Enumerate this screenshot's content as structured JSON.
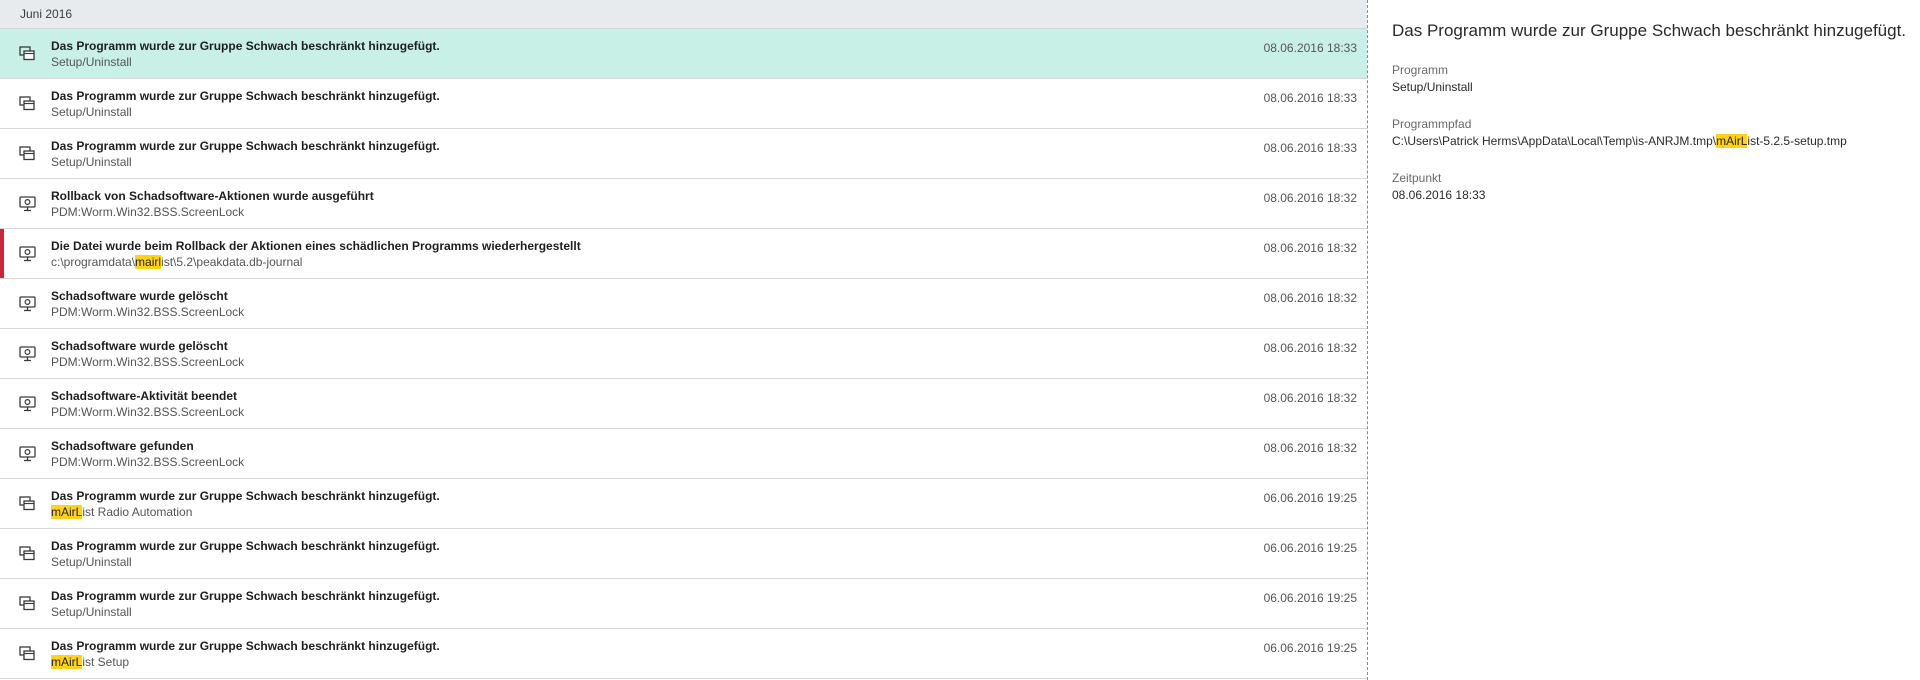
{
  "list": {
    "group_header": "Juni 2016",
    "rows": [
      {
        "icon": "app-window-icon",
        "title": "Das Programm wurde zur Gruppe Schwach beschränkt hinzugefügt.",
        "sub_pre": "Setup/Uninstall",
        "sub_hl": "",
        "sub_post": "",
        "time": "08.06.2016 18:33",
        "selected": true,
        "flagged": false
      },
      {
        "icon": "app-window-icon",
        "title": "Das Programm wurde zur Gruppe Schwach beschränkt hinzugefügt.",
        "sub_pre": "Setup/Uninstall",
        "sub_hl": "",
        "sub_post": "",
        "time": "08.06.2016 18:33",
        "selected": false,
        "flagged": false
      },
      {
        "icon": "app-window-icon",
        "title": "Das Programm wurde zur Gruppe Schwach beschränkt hinzugefügt.",
        "sub_pre": "Setup/Uninstall",
        "sub_hl": "",
        "sub_post": "",
        "time": "08.06.2016 18:33",
        "selected": false,
        "flagged": false
      },
      {
        "icon": "monitor-scan-icon",
        "title": "Rollback von Schadsoftware-Aktionen wurde ausgeführt",
        "sub_pre": "PDM:Worm.Win32.BSS.ScreenLock",
        "sub_hl": "",
        "sub_post": "",
        "time": "08.06.2016 18:32",
        "selected": false,
        "flagged": false
      },
      {
        "icon": "monitor-scan-icon",
        "title": "Die Datei wurde beim Rollback der Aktionen eines schädlichen Programms wiederhergestellt",
        "sub_pre": "c:\\programdata\\",
        "sub_hl": "mairl",
        "sub_post": "ist\\5.2\\peakdata.db-journal",
        "time": "08.06.2016 18:32",
        "selected": false,
        "flagged": true
      },
      {
        "icon": "monitor-scan-icon",
        "title": "Schadsoftware wurde gelöscht",
        "sub_pre": "PDM:Worm.Win32.BSS.ScreenLock",
        "sub_hl": "",
        "sub_post": "",
        "time": "08.06.2016 18:32",
        "selected": false,
        "flagged": false
      },
      {
        "icon": "monitor-scan-icon",
        "title": "Schadsoftware wurde gelöscht",
        "sub_pre": "PDM:Worm.Win32.BSS.ScreenLock",
        "sub_hl": "",
        "sub_post": "",
        "time": "08.06.2016 18:32",
        "selected": false,
        "flagged": false
      },
      {
        "icon": "monitor-scan-icon",
        "title": "Schadsoftware-Aktivität beendet",
        "sub_pre": "PDM:Worm.Win32.BSS.ScreenLock",
        "sub_hl": "",
        "sub_post": "",
        "time": "08.06.2016 18:32",
        "selected": false,
        "flagged": false
      },
      {
        "icon": "monitor-scan-icon",
        "title": "Schadsoftware gefunden",
        "sub_pre": "PDM:Worm.Win32.BSS.ScreenLock",
        "sub_hl": "",
        "sub_post": "",
        "time": "08.06.2016 18:32",
        "selected": false,
        "flagged": false
      },
      {
        "icon": "app-window-icon",
        "title": "Das Programm wurde zur Gruppe Schwach beschränkt hinzugefügt.",
        "sub_pre": "",
        "sub_hl": "mAirL",
        "sub_post": "ist Radio Automation",
        "time": "06.06.2016 19:25",
        "selected": false,
        "flagged": false
      },
      {
        "icon": "app-window-icon",
        "title": "Das Programm wurde zur Gruppe Schwach beschränkt hinzugefügt.",
        "sub_pre": "Setup/Uninstall",
        "sub_hl": "",
        "sub_post": "",
        "time": "06.06.2016 19:25",
        "selected": false,
        "flagged": false
      },
      {
        "icon": "app-window-icon",
        "title": "Das Programm wurde zur Gruppe Schwach beschränkt hinzugefügt.",
        "sub_pre": "Setup/Uninstall",
        "sub_hl": "",
        "sub_post": "",
        "time": "06.06.2016 19:25",
        "selected": false,
        "flagged": false
      },
      {
        "icon": "app-window-icon",
        "title": "Das Programm wurde zur Gruppe Schwach beschränkt hinzugefügt.",
        "sub_pre": "",
        "sub_hl": "mAirL",
        "sub_post": "ist Setup",
        "time": "06.06.2016 19:25",
        "selected": false,
        "flagged": false
      }
    ]
  },
  "details": {
    "title": "Das Programm wurde zur Gruppe Schwach beschränkt hinzugefügt.",
    "program_label": "Programm",
    "program_value": "Setup/Uninstall",
    "path_label": "Programmpfad",
    "path_pre": "C:\\Users\\Patrick Herms\\AppData\\Local\\Temp\\is-ANRJM.tmp\\",
    "path_hl": "mAirL",
    "path_post": "ist-5.2.5-setup.tmp",
    "time_label": "Zeitpunkt",
    "time_value": "08.06.2016 18:33"
  },
  "colors": {
    "selected_row": "#c9f0e6",
    "flag": "#c8283c",
    "highlight": "#ffd21a",
    "group_header": "#e8ebee"
  }
}
